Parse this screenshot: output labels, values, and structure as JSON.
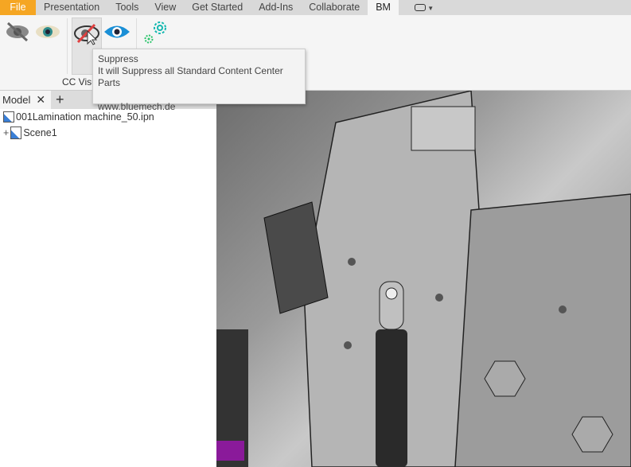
{
  "menu_tabs": [
    "File",
    "Presentation",
    "Tools",
    "View",
    "Get Started",
    "Add-Ins",
    "Collaborate",
    "BM"
  ],
  "active_tab": "BM",
  "ribbon": {
    "group_label": "CC Visu"
  },
  "tooltip": {
    "title": "Suppress",
    "description": "It will Suppress all Standard Content Center Parts",
    "link": "www.bluemech.de"
  },
  "browser": {
    "tab_label": "Model",
    "items": [
      {
        "label": "001Lamination machine_50.ipn"
      },
      {
        "label": "Scene1"
      }
    ]
  },
  "colors": {
    "file_tab": "#f5a623",
    "eye_blue": "#1a8fd6",
    "gear": "#14b8b0"
  }
}
